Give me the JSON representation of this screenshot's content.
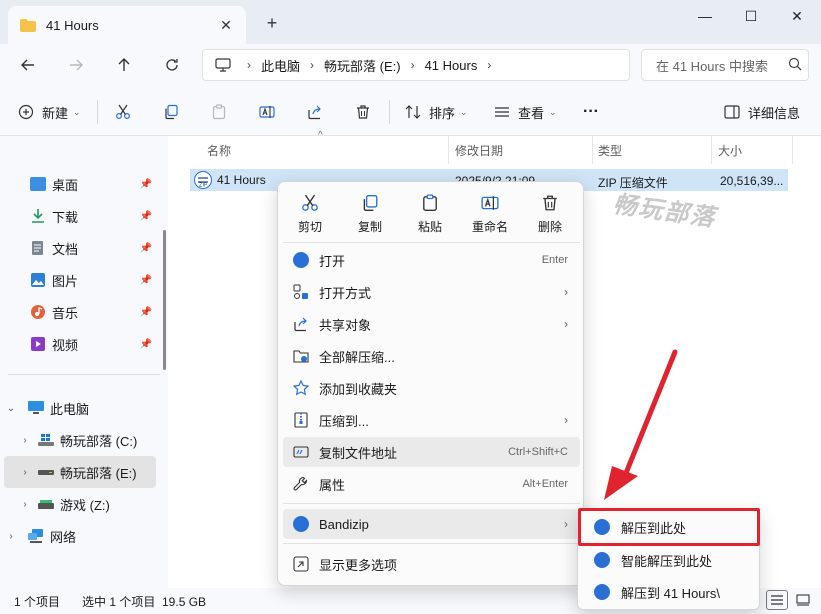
{
  "window": {
    "tab_title": "41 Hours",
    "tab_close": "✕",
    "new_tab": "+",
    "minimize": "—",
    "maximize": "☐",
    "close": "✕"
  },
  "address": {
    "crumbs": [
      "此电脑",
      "畅玩部落 (E:)",
      "41 Hours"
    ],
    "search_placeholder": "在 41 Hours 中搜索"
  },
  "toolbar": {
    "new_label": "新建",
    "sort_label": "排序",
    "view_label": "查看",
    "more_label": "···",
    "details_label": "详细信息"
  },
  "sidebar": {
    "quick_access": [
      "桌面",
      "下载",
      "文档",
      "图片",
      "音乐",
      "视频"
    ],
    "this_pc": "此电脑",
    "drives": [
      "畅玩部落 (C:)",
      "畅玩部落 (E:)",
      "游戏 (Z:)"
    ],
    "network": "网络"
  },
  "columns": {
    "name": "名称",
    "date": "修改日期",
    "type": "类型",
    "size": "大小"
  },
  "file": {
    "name": "41 Hours",
    "date": "2025/9/2 21:09",
    "type": "ZIP 压缩文件",
    "size": "20,516,39..."
  },
  "watermark": "畅玩部落",
  "context_menu": {
    "quick_actions": [
      "剪切",
      "复制",
      "粘贴",
      "重命名",
      "删除"
    ],
    "items": [
      {
        "label": "打开",
        "shortcut": "Enter"
      },
      {
        "label": "打开方式",
        "shortcut": ""
      },
      {
        "label": "共享对象",
        "shortcut": ""
      },
      {
        "label": "全部解压缩...",
        "shortcut": ""
      },
      {
        "label": "添加到收藏夹",
        "shortcut": ""
      },
      {
        "label": "压缩到...",
        "shortcut": ""
      },
      {
        "label": "复制文件地址",
        "shortcut": "Ctrl+Shift+C"
      },
      {
        "label": "属性",
        "shortcut": "Alt+Enter"
      },
      {
        "label": "Bandizip",
        "shortcut": ""
      },
      {
        "label": "显示更多选项",
        "shortcut": ""
      }
    ],
    "arrow": "›"
  },
  "submenu": {
    "items": [
      "解压到此处",
      "智能解压到此处",
      "解压到 41 Hours\\"
    ]
  },
  "status": {
    "count": "1 个项目",
    "selected": "选中 1 个项目  19.5 GB"
  },
  "colors": {
    "accent": "#2a6fd6",
    "highlight": "#e0242f",
    "selection": "#cfe4f7"
  }
}
